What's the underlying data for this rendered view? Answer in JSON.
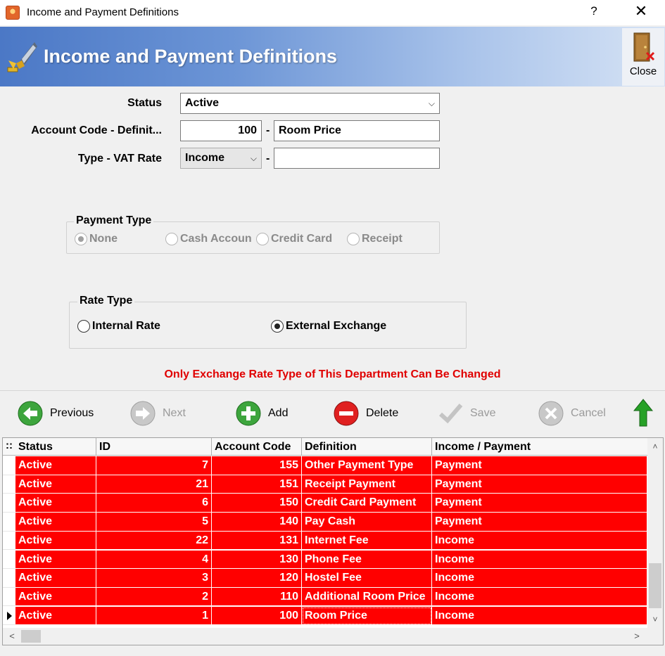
{
  "window": {
    "title": "Income and Payment Definitions",
    "help": "?",
    "close": "✕"
  },
  "banner": {
    "title": "Income and Payment Definitions",
    "close_label": "Close"
  },
  "form": {
    "status_label": "Status",
    "status_value": "Active",
    "account_label": "Account Code - Definit...",
    "account_code": "100",
    "account_definition": "Room Price",
    "type_label": "Type - VAT Rate",
    "type_value": "Income",
    "vat_rate": "",
    "dash": "-"
  },
  "payment_type": {
    "title": "Payment Type",
    "options": [
      {
        "label": "None",
        "selected": true
      },
      {
        "label": "Cash Accoun",
        "selected": false
      },
      {
        "label": "Credit Card",
        "selected": false
      },
      {
        "label": "Receipt",
        "selected": false
      }
    ]
  },
  "rate_type": {
    "title": "Rate Type",
    "options": [
      {
        "label": "Internal Rate",
        "selected": false
      },
      {
        "label": "External Exchange",
        "selected": true
      }
    ]
  },
  "notice": "Only Exchange Rate Type of This Department Can Be Changed",
  "toolbar": {
    "previous": "Previous",
    "next": "Next",
    "add": "Add",
    "delete": "Delete",
    "save": "Save",
    "cancel": "Cancel"
  },
  "grid": {
    "indicator": "::",
    "columns": [
      "Status",
      "ID",
      "Account Code",
      "Definition",
      "Income / Payment"
    ],
    "rows": [
      [
        "Active",
        "7",
        "155",
        "Other Payment Type",
        "Payment"
      ],
      [
        "Active",
        "21",
        "151",
        "Receipt Payment",
        "Payment"
      ],
      [
        "Active",
        "6",
        "150",
        "Credit Card Payment",
        "Payment"
      ],
      [
        "Active",
        "5",
        "140",
        "Pay Cash",
        "Payment"
      ],
      [
        "Active",
        "22",
        "131",
        "Internet Fee",
        "Income"
      ],
      [
        "Active",
        "4",
        "130",
        "Phone Fee",
        "Income"
      ],
      [
        "Active",
        "3",
        "120",
        "Hostel Fee",
        "Income"
      ],
      [
        "Active",
        "2",
        "110",
        "Additional Room Price",
        "Income"
      ],
      [
        "Active",
        "1",
        "100",
        "Room Price",
        "Income"
      ]
    ],
    "current_row": 8,
    "row_color": "#ff0000"
  },
  "colors": {
    "banner_start": "#4b78c6",
    "notice": "#e00000"
  }
}
